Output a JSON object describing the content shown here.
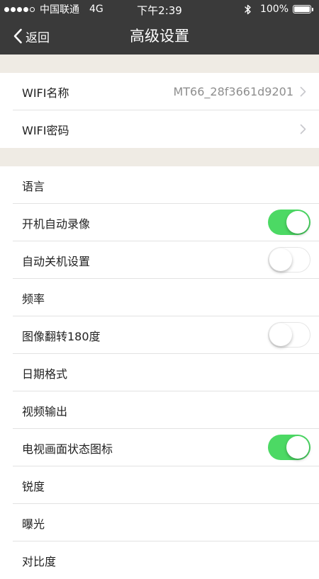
{
  "status_bar": {
    "carrier": "中国联通",
    "network": "4G",
    "time": "下午2:39",
    "battery": "100%",
    "battery_level": 1.0,
    "signal_bars": 4,
    "signal_total": 5
  },
  "nav": {
    "back_label": "返回",
    "title": "高级设置"
  },
  "wifi_section": {
    "name_label": "WIFI名称",
    "name_value": "MT66_28f3661d9201",
    "password_label": "WIFI密码"
  },
  "settings": {
    "language": "语言",
    "auto_record": "开机自动录像",
    "auto_shutdown": "自动关机设置",
    "frequency": "频率",
    "image_flip": "图像翻转180度",
    "date_format": "日期格式",
    "video_output": "视频输出",
    "osd_icon": "电视画面状态图标",
    "sharpness": "锐度",
    "exposure": "曝光",
    "contrast": "对比度"
  },
  "toggles": {
    "auto_record": true,
    "auto_shutdown": false,
    "image_flip": false,
    "osd_icon": true
  },
  "colors": {
    "header_bg": "#3a3a3a",
    "toggle_on": "#4cd964",
    "section_gap": "#efebe4",
    "secondary_text": "#8e8e8e"
  }
}
